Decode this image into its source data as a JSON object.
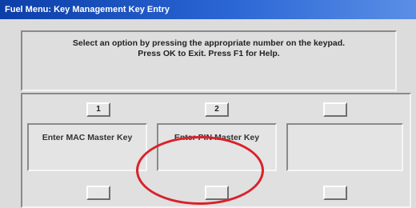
{
  "window": {
    "title": "Fuel Menu: Key Management Key Entry"
  },
  "instructions": {
    "line1": "Select an option by pressing the appropriate number on the keypad.",
    "line2": "Press OK to Exit.  Press F1 for Help."
  },
  "options": [
    {
      "number": "1",
      "label": "Enter MAC Master Key",
      "enabled": true
    },
    {
      "number": "2",
      "label": "Enter PIN Master Key",
      "enabled": true
    },
    {
      "number": "",
      "label": "",
      "enabled": false
    }
  ],
  "highlight": {
    "color": "#d8222a"
  }
}
